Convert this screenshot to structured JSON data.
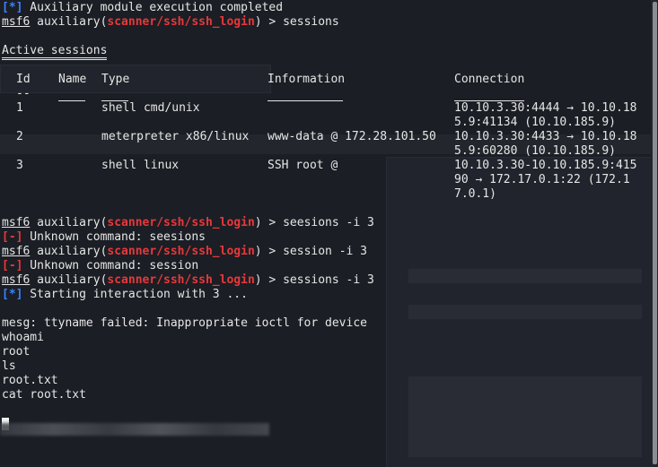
{
  "lines": {
    "l1_tag": "[*]",
    "l1_text": " Auxiliary module execution completed",
    "prompt_prefix": "msf6",
    "prompt_mod": " auxiliary(",
    "prompt_path": "scanner/ssh/ssh_login",
    "prompt_close": ") > ",
    "cmd1": "sessions",
    "active_title": "Active sessions",
    "cmd2": "seesions -i 3",
    "err_tag": "[-]",
    "err1": " Unknown command: seesions",
    "cmd3": "session -i 3",
    "err2": " Unknown command: session",
    "cmd4": "sessions -i 3",
    "info_tag": "[*]",
    "start": " Starting interaction with 3 ...",
    "mesg": "mesg: ttyname failed: Inappropriate ioctl for device",
    "whoami": "whoami",
    "root": "root",
    "ls": "ls",
    "file": "root.txt",
    "cat": "cat root.txt"
  },
  "table": {
    "headers": {
      "id": "Id",
      "name": "Name",
      "type": "Type",
      "info": "Information",
      "conn": "Connection"
    },
    "underline_id": "--",
    "rows": [
      {
        "id": "1",
        "name": "",
        "type": "shell cmd/unix",
        "info": "",
        "conn": "10.10.3.30:4444 → 10.10.185.9:41134 (10.10.185.9)"
      },
      {
        "id": "2",
        "name": "",
        "type": "meterpreter x86/linux",
        "info": "www-data @ 172.28.101.50",
        "conn": "10.10.3.30:4433 → 10.10.185.9:60280 (10.10.185.9)"
      },
      {
        "id": "3",
        "name": "",
        "type": "shell linux",
        "info": "SSH root @",
        "conn": "10.10.3.30-10.10.185.9:41590 → 172.17.0.1:22 (172.17.0.1)"
      }
    ]
  },
  "colors": {
    "background": "#1b1e24",
    "text": "#e6e6e6",
    "info_blue": "#3a82ff",
    "error_red": "#e8383b"
  }
}
